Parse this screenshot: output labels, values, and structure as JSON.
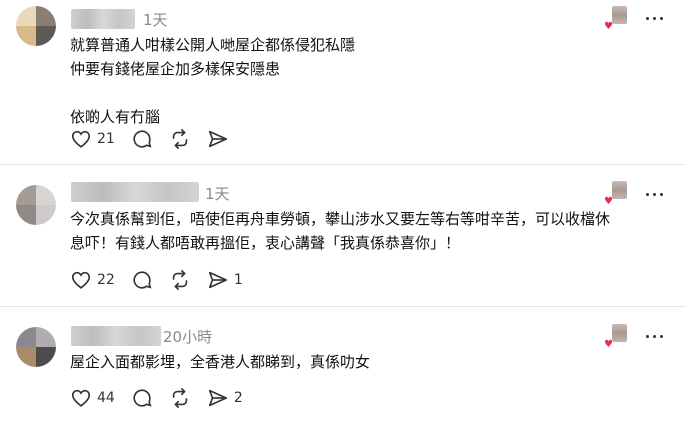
{
  "comments": [
    {
      "time": "1天",
      "lines": [
        "就算普通人咁樣公開人哋屋企都係侵犯私隱",
        "仲要有錢佬屋企加多樣保安隱患",
        "",
        "依啲人有冇腦"
      ],
      "likes": "21",
      "replies": "",
      "reposts": "",
      "avatar_colors": [
        "#e9d8b9",
        "#8b7d6f",
        "#d9b98a",
        "#5d5a57"
      ]
    },
    {
      "time": "1天",
      "lines": [
        "今次真係幫到佢，唔使佢再舟車勞頓，攀山涉水又要左等右等咁辛苦，可以收檔休",
        "息吓！有錢人都唔敢再搵佢，衷心講聲「我真係恭喜你」！"
      ],
      "likes": "22",
      "replies": "",
      "reposts": "1",
      "avatar_colors": [
        "#a69a95",
        "#d7d4d2",
        "#8e8a88",
        "#cfcaca"
      ]
    },
    {
      "time": "20小時",
      "lines": [
        "屋企入面都影埋，全香港人都睇到，真係叻女"
      ],
      "likes": "44",
      "replies": "",
      "reposts": "2",
      "avatar_colors": [
        "#8c8791",
        "#b0acb2",
        "#a68c67",
        "#4e4a4e"
      ]
    }
  ],
  "icons": {
    "like": "heart-icon",
    "reply": "comment-icon",
    "repost": "repost-icon",
    "share": "share-icon",
    "more": "more-icon"
  },
  "colors": {
    "text": "#111111",
    "muted": "#8a8a8a",
    "heart": "#e6304a"
  }
}
